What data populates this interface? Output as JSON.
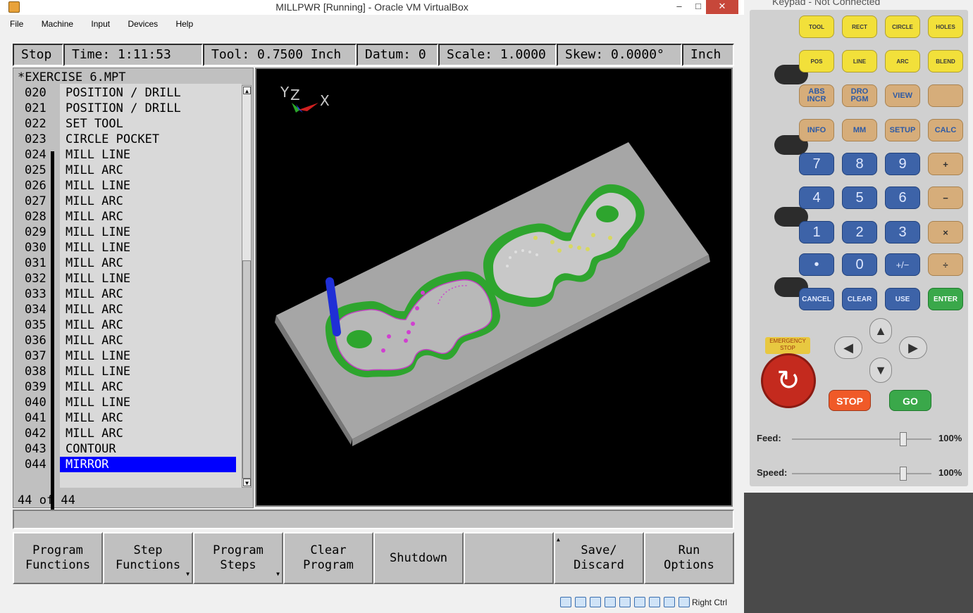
{
  "window": {
    "title": "MILLPWR [Running] - Oracle VM VirtualBox",
    "controls": [
      "–",
      "□",
      "✕"
    ]
  },
  "menu": [
    "File",
    "Machine",
    "Input",
    "Devices",
    "Help"
  ],
  "status": {
    "state": "Stop",
    "time": "Time: 1:11:53",
    "tool": "Tool: 0.7500 Inch",
    "datum": "Datum: 0",
    "scale": "Scale: 1.0000",
    "skew": "Skew: 0.0000°",
    "units": "Inch"
  },
  "program": {
    "filename": "*EXERCISE 6.MPT",
    "lines": [
      {
        "num": "020",
        "text": "POSITION / DRILL"
      },
      {
        "num": "021",
        "text": "POSITION / DRILL"
      },
      {
        "num": "022",
        "text": "SET TOOL"
      },
      {
        "num": "023",
        "text": "CIRCLE POCKET"
      },
      {
        "num": "024",
        "text": "MILL LINE"
      },
      {
        "num": "025",
        "text": "MILL ARC"
      },
      {
        "num": "026",
        "text": "MILL LINE"
      },
      {
        "num": "027",
        "text": "MILL ARC"
      },
      {
        "num": "028",
        "text": "MILL ARC"
      },
      {
        "num": "029",
        "text": "MILL LINE"
      },
      {
        "num": "030",
        "text": "MILL LINE"
      },
      {
        "num": "031",
        "text": "MILL ARC"
      },
      {
        "num": "032",
        "text": "MILL LINE"
      },
      {
        "num": "033",
        "text": "MILL ARC"
      },
      {
        "num": "034",
        "text": "MILL ARC"
      },
      {
        "num": "035",
        "text": "MILL ARC"
      },
      {
        "num": "036",
        "text": "MILL ARC"
      },
      {
        "num": "037",
        "text": "MILL LINE"
      },
      {
        "num": "038",
        "text": "MILL LINE"
      },
      {
        "num": "039",
        "text": "MILL ARC"
      },
      {
        "num": "040",
        "text": "MILL LINE"
      },
      {
        "num": "041",
        "text": "MILL ARC"
      },
      {
        "num": "042",
        "text": "MILL ARC"
      },
      {
        "num": "043",
        "text": "CONTOUR"
      },
      {
        "num": "044",
        "text": "MIRROR"
      }
    ],
    "selected_index": 24,
    "count": "44 of 44"
  },
  "view3d": {
    "axis_labels": {
      "y": "Y",
      "z": "Z",
      "x": "X"
    },
    "colors": {
      "plate": "#a6a6a6",
      "pocket": "#2ea52e",
      "tool": "#1f2fd6",
      "path": "#c040c0"
    }
  },
  "softkeys": [
    {
      "label": "Program\nFunctions",
      "submenu": false
    },
    {
      "label": "Step\nFunctions",
      "submenu": true
    },
    {
      "label": "Program\nSteps",
      "submenu": true
    },
    {
      "label": "Clear\nProgram",
      "submenu": false
    },
    {
      "label": "Shutdown",
      "submenu": false
    },
    {
      "label": "",
      "submenu": false
    },
    {
      "label": "Save/\nDiscard",
      "submenu": false
    },
    {
      "label": "Run\nOptions",
      "submenu": false
    }
  ],
  "host_status": {
    "right_ctrl": "Right Ctrl"
  },
  "keypad": {
    "title": "Keypad - Not Connected",
    "row1": [
      "TOOL",
      "RECT",
      "CIRCLE",
      "HOLES"
    ],
    "row2": [
      "POS",
      "LINE",
      "ARC",
      "BLEND"
    ],
    "row3": [
      "ABS\nINCR",
      "DRO\nPGM",
      "VIEW",
      ""
    ],
    "row4": [
      "INFO",
      "MM",
      "SETUP",
      "CALC"
    ],
    "row5": [
      "7",
      "8",
      "9",
      "+"
    ],
    "row6": [
      "4",
      "5",
      "6",
      "−"
    ],
    "row7": [
      "1",
      "2",
      "3",
      "×"
    ],
    "row8": [
      "•",
      "0",
      "+/−",
      "÷"
    ],
    "row9": [
      "CANCEL",
      "CLEAR",
      "USE",
      "ENTER"
    ],
    "emergency_stop": "EMERGENCY STOP",
    "stop": "STOP",
    "go": "GO",
    "feed_label": "Feed:",
    "feed_value": "100%",
    "feed_level": 0.8,
    "speed_label": "Speed:",
    "speed_value": "100%",
    "speed_level": 0.8
  }
}
